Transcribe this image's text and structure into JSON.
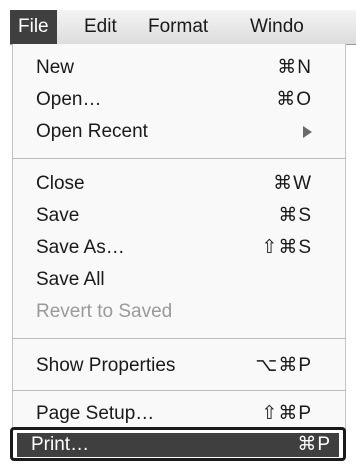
{
  "menubar": {
    "items": [
      {
        "label": "File",
        "active": true
      },
      {
        "label": "Edit"
      },
      {
        "label": "Format"
      },
      {
        "label": "Windo"
      }
    ]
  },
  "file_menu": {
    "items": [
      {
        "label": "New",
        "shortcut": "⌘N"
      },
      {
        "label": "Open…",
        "shortcut": "⌘O"
      },
      {
        "label": "Open Recent",
        "submenu_icon": "submenu-arrow-icon"
      },
      {
        "label": "Close",
        "shortcut": "⌘W"
      },
      {
        "label": "Save",
        "shortcut": "⌘S"
      },
      {
        "label": "Save As…",
        "shortcut": "⇧⌘S"
      },
      {
        "label": "Save All"
      },
      {
        "label": "Revert to Saved",
        "disabled": true
      },
      {
        "label": "Show Properties",
        "shortcut": "⌥⌘P"
      },
      {
        "label": "Page Setup…",
        "shortcut": "⇧⌘P"
      },
      {
        "label": "Print…",
        "shortcut": "⌘P",
        "highlighted": true
      }
    ]
  }
}
